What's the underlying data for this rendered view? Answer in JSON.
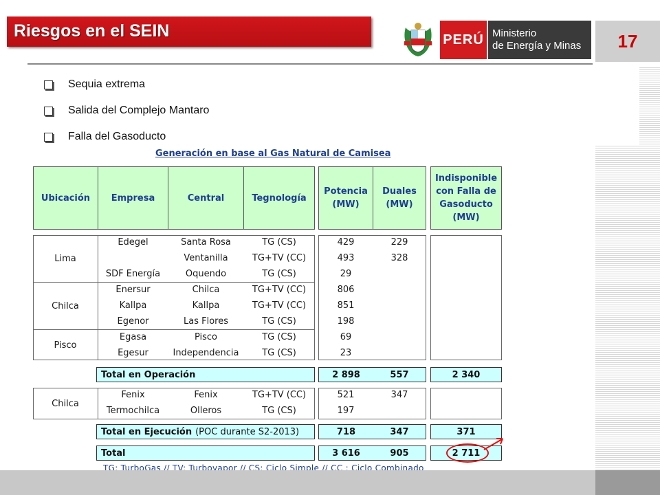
{
  "slide": {
    "title": "Riesgos en el SEIN",
    "page_number": "17",
    "brand": {
      "country": "PERÚ",
      "ministry_line1": "Ministerio",
      "ministry_line2": "de Energía y Minas"
    },
    "colors": {
      "title_bar": "#c4131a",
      "header_fill": "#ccffcc",
      "total_fill": "#ccffff",
      "heading_text": "#1f3f8f",
      "highlight": "#e01010"
    }
  },
  "bullets": [
    "Sequia extrema",
    "Salida del Complejo Mantaro",
    "Falla del Gasoducto"
  ],
  "table": {
    "title": "Generación en base al Gas Natural de Camisea",
    "headers": {
      "ubicacion": "Ubicación",
      "empresa": "Empresa",
      "central": "Central",
      "tecnologia": "Tegnología",
      "potencia": [
        "Potencia",
        "(MW)"
      ],
      "duales": [
        "Duales",
        "(MW)"
      ],
      "indisponible": [
        "Indisponible",
        "con Falla de",
        "Gasoducto",
        "(MW)"
      ]
    },
    "groups": [
      {
        "location": "Lima",
        "rows": [
          {
            "empresa": "Edegel",
            "central": "Santa Rosa",
            "tecnologia": "TG (CS)",
            "potencia": "429",
            "duales": "229"
          },
          {
            "empresa": "",
            "central": "Ventanilla",
            "tecnologia": "TG+TV (CC)",
            "potencia": "493",
            "duales": "328"
          },
          {
            "empresa": "SDF Energía",
            "central": "Oquendo",
            "tecnologia": "TG (CS)",
            "potencia": "29",
            "duales": ""
          }
        ]
      },
      {
        "location": "Chilca",
        "rows": [
          {
            "empresa": "Enersur",
            "central": "Chilca",
            "tecnologia": "TG+TV (CC)",
            "potencia": "806",
            "duales": ""
          },
          {
            "empresa": "Kallpa",
            "central": "Kallpa",
            "tecnologia": "TG+TV (CC)",
            "potencia": "851",
            "duales": ""
          },
          {
            "empresa": "Egenor",
            "central": "Las Flores",
            "tecnologia": "TG (CS)",
            "potencia": "198",
            "duales": ""
          }
        ]
      },
      {
        "location": "Pisco",
        "rows": [
          {
            "empresa": "Egasa",
            "central": "Pisco",
            "tecnologia": "TG (CS)",
            "potencia": "69",
            "duales": ""
          },
          {
            "empresa": "Egesur",
            "central": "Independencia",
            "tecnologia": "TG (CS)",
            "potencia": "23",
            "duales": ""
          }
        ]
      },
      {
        "location": "Chilca",
        "rows": [
          {
            "empresa": "Fenix",
            "central": "Fenix",
            "tecnologia": "TG+TV (CC)",
            "potencia": "521",
            "duales": "347"
          },
          {
            "empresa": "Termochilca",
            "central": "Olleros",
            "tecnologia": "TG (CS)",
            "potencia": "197",
            "duales": ""
          }
        ]
      }
    ],
    "totals": {
      "operacion": {
        "label": "Total en Operación",
        "potencia": "2 898",
        "duales": "557",
        "indisponible": "2 340"
      },
      "ejecucion": {
        "label": "Total en Ejecución",
        "note": "(POC durante S2-2013)",
        "potencia": "718",
        "duales": "347",
        "indisponible": "371"
      },
      "total": {
        "label": "Total",
        "potencia": "3 616",
        "duales": "905",
        "indisponible": "2 711"
      }
    },
    "footnote": "TG: TurboGas   //   TV: Turbovapor   //   CS: Ciclo Simple   //   CC : Ciclo Combinado"
  }
}
